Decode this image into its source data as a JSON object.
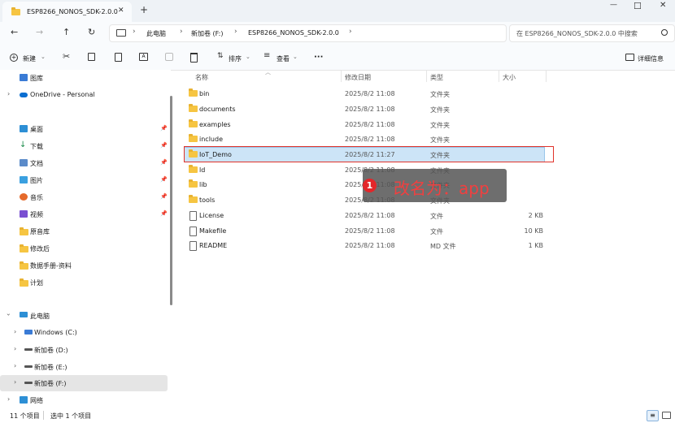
{
  "window": {
    "tab_title": "ESP8266_NONOS_SDK-2.0.0",
    "tab_close": "✕",
    "new_tab": "+",
    "minimize": "—",
    "maximize": "☐",
    "close": "✕"
  },
  "nav": {
    "back": "←",
    "forward": "→",
    "up": "↑",
    "refresh": "↻",
    "breadcrumb": [
      "此电脑",
      "新加卷 (F:)",
      "ESP8266_NONOS_SDK-2.0.0"
    ],
    "search_placeholder": "在 ESP8266_NONOS_SDK-2.0.0 中搜索"
  },
  "toolbar": {
    "new_label": "新建",
    "sort_label": "排序",
    "view_label": "查看",
    "more_label": "···",
    "details_label": "详细信息"
  },
  "sidebar": {
    "items": [
      {
        "label": "图库",
        "icon": "gallery-icon"
      },
      {
        "label": "OneDrive - Personal",
        "icon": "cloud-icon"
      },
      {
        "label": "桌面",
        "icon": "desktop-icon"
      },
      {
        "label": "下载",
        "icon": "download-icon"
      },
      {
        "label": "文档",
        "icon": "documents-icon"
      },
      {
        "label": "图片",
        "icon": "pictures-icon"
      },
      {
        "label": "音乐",
        "icon": "music-icon"
      },
      {
        "label": "视频",
        "icon": "videos-icon"
      },
      {
        "label": "原音库",
        "icon": "folder-icon"
      },
      {
        "label": "修改后",
        "icon": "folder-icon"
      },
      {
        "label": "数据手册-资料",
        "icon": "folder-icon"
      },
      {
        "label": "计划",
        "icon": "folder-icon"
      },
      {
        "label": "此电脑",
        "icon": "computer-icon"
      },
      {
        "label": "Windows (C:)",
        "icon": "drive-icon"
      },
      {
        "label": "新加卷 (D:)",
        "icon": "drive-icon"
      },
      {
        "label": "新加卷 (E:)",
        "icon": "drive-icon"
      },
      {
        "label": "新加卷 (F:)",
        "icon": "drive-icon"
      },
      {
        "label": "网络",
        "icon": "network-icon"
      }
    ]
  },
  "columns": {
    "name": "名称",
    "date": "修改日期",
    "type": "类型",
    "size": "大小"
  },
  "files": [
    {
      "name": "bin",
      "date": "2025/8/2 11:08",
      "type": "文件夹",
      "size": "",
      "kind": "folder"
    },
    {
      "name": "documents",
      "date": "2025/8/2 11:08",
      "type": "文件夹",
      "size": "",
      "kind": "folder"
    },
    {
      "name": "examples",
      "date": "2025/8/2 11:08",
      "type": "文件夹",
      "size": "",
      "kind": "folder"
    },
    {
      "name": "include",
      "date": "2025/8/2 11:08",
      "type": "文件夹",
      "size": "",
      "kind": "folder"
    },
    {
      "name": "IoT_Demo",
      "date": "2025/8/2 11:27",
      "type": "文件夹",
      "size": "",
      "kind": "folder"
    },
    {
      "name": "ld",
      "date": "2025/8/2 11:08",
      "type": "文件夹",
      "size": "",
      "kind": "folder"
    },
    {
      "name": "lib",
      "date": "2025/8/2 11:08",
      "type": "文件夹",
      "size": "",
      "kind": "folder"
    },
    {
      "name": "tools",
      "date": "2025/8/2 11:08",
      "type": "文件夹",
      "size": "",
      "kind": "folder"
    },
    {
      "name": "License",
      "date": "2025/8/2 11:08",
      "type": "文件",
      "size": "2 KB",
      "kind": "file"
    },
    {
      "name": "Makefile",
      "date": "2025/8/2 11:08",
      "type": "文件",
      "size": "10 KB",
      "kind": "file"
    },
    {
      "name": "README",
      "date": "2025/8/2 11:08",
      "type": "MD 文件",
      "size": "1 KB",
      "kind": "file"
    }
  ],
  "annotation": {
    "number": "1",
    "text": "改名为：app"
  },
  "status": {
    "count": "11 个项目",
    "selected": "选中 1 个项目"
  },
  "colors": {
    "selection": "#cce4f7",
    "highlight_box": "#e0322a",
    "folder": "#f6c542",
    "accent": "#0067c0"
  }
}
